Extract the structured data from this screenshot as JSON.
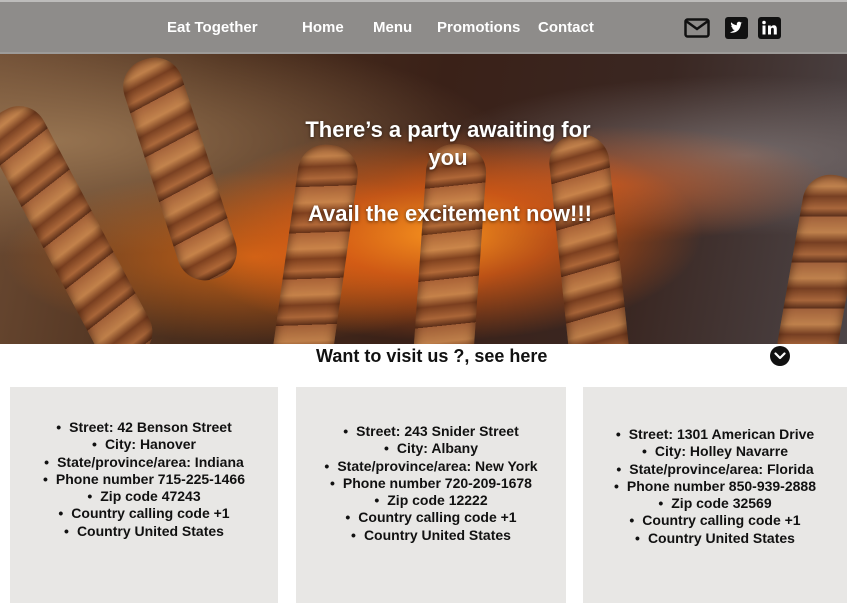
{
  "nav": {
    "brand": "Eat Together",
    "links": [
      "Home",
      "Menu",
      "Promotions",
      "Contact"
    ],
    "social_icons": [
      "mail-icon",
      "twitter-icon",
      "linkedin-icon"
    ]
  },
  "hero": {
    "headline": "There’s a party awaiting for you",
    "cta": "Avail the excitement now!!!"
  },
  "visit": {
    "title": "Want to visit us ?, see here",
    "toggle_icon": "chevron-down-icon"
  },
  "locations": [
    {
      "street": "Street: 42 Benson Street",
      "city": "City: Hanover",
      "state": "State/province/area: Indiana",
      "phone": "Phone number 715-225-1466",
      "zip": "Zip code 47243",
      "calling_code": "Country calling code +1",
      "country": "Country United States"
    },
    {
      "street": "Street: 243 Snider Street",
      "city": "City: Albany",
      "state": "State/province/area: New York",
      "phone": "Phone number 720-209-1678",
      "zip": "Zip code 12222",
      "calling_code": "Country calling code +1",
      "country": "Country United States"
    },
    {
      "street": "Street: 1301 American Drive",
      "city": "City: Holley Navarre",
      "state": "State/province/area: Florida",
      "phone": "Phone number 850-939-2888",
      "zip": "Zip code 32569",
      "calling_code": "Country calling code +1",
      "country": "Country United States"
    }
  ],
  "colors": {
    "navbar": "#8e8c8a",
    "card_background": "#e8e7e5",
    "text_dark": "#111111",
    "text_light": "#ffffff"
  }
}
